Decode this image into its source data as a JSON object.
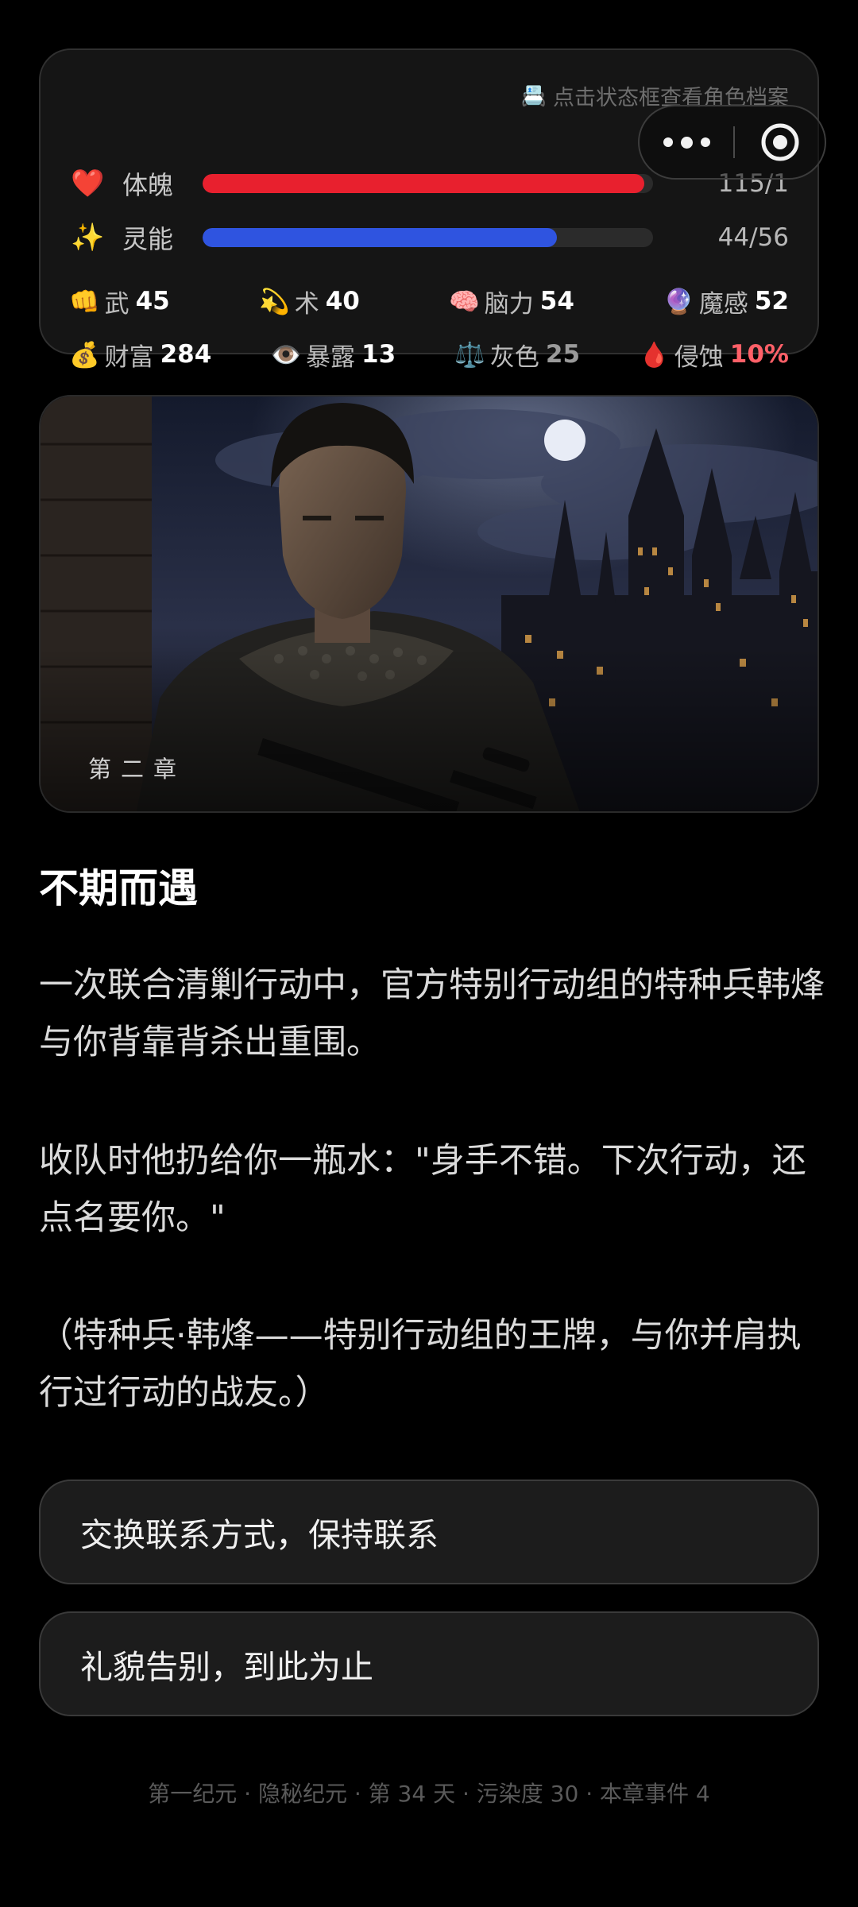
{
  "status": {
    "archive_hint": "点击状态框查看角色档案",
    "archive_icon": "📇",
    "hp": {
      "icon": "❤️",
      "label": "体魄",
      "value": "115/1",
      "current": 115,
      "max": 115,
      "fill": 0.98
    },
    "sp": {
      "icon": "✨",
      "label": "灵能",
      "value": "44/56",
      "current": 44,
      "max": 56,
      "fill": 0.786
    },
    "attributes_row1": [
      {
        "icon": "👊",
        "name": "武",
        "value": "45"
      },
      {
        "icon": "💫",
        "name": "术",
        "value": "40"
      },
      {
        "icon": "🧠",
        "name": "脑力",
        "value": "54"
      },
      {
        "icon": "🔮",
        "name": "魔感",
        "value": "52"
      }
    ],
    "attributes_row2": [
      {
        "icon": "💰",
        "name": "财富",
        "value": "284"
      },
      {
        "icon": "👁️",
        "name": "暴露",
        "value": "13"
      },
      {
        "icon": "⚖️",
        "name": "灰色",
        "value": "25"
      },
      {
        "icon": "🩸",
        "name": "侵蚀",
        "value": "10%"
      }
    ]
  },
  "capsule": {
    "more_icon": "more-dots-icon",
    "close_icon": "target-close-icon"
  },
  "hero": {
    "chapter": "第二章"
  },
  "story": {
    "title": "不期而遇",
    "paragraphs": [
      "一次联合清剿行动中，官方特别行动组的特种兵韩烽与你背靠背杀出重围。",
      "收队时他扔给你一瓶水：\"身手不错。下次行动，还点名要你。\"",
      "（特种兵·韩烽——特别行动组的王牌，与你并肩执行过行动的战友。）"
    ]
  },
  "choices": [
    "交换联系方式，保持联系",
    "礼貌告别，到此为止"
  ],
  "footer": "第一纪元 · 隐秘纪元 · 第 34 天 · 污染度 30 · 本章事件 4",
  "colors": {
    "background": "#000000",
    "hp_bar": "#e8202e",
    "sp_bar": "#2f54e0",
    "danger_text": "#ff6068"
  }
}
